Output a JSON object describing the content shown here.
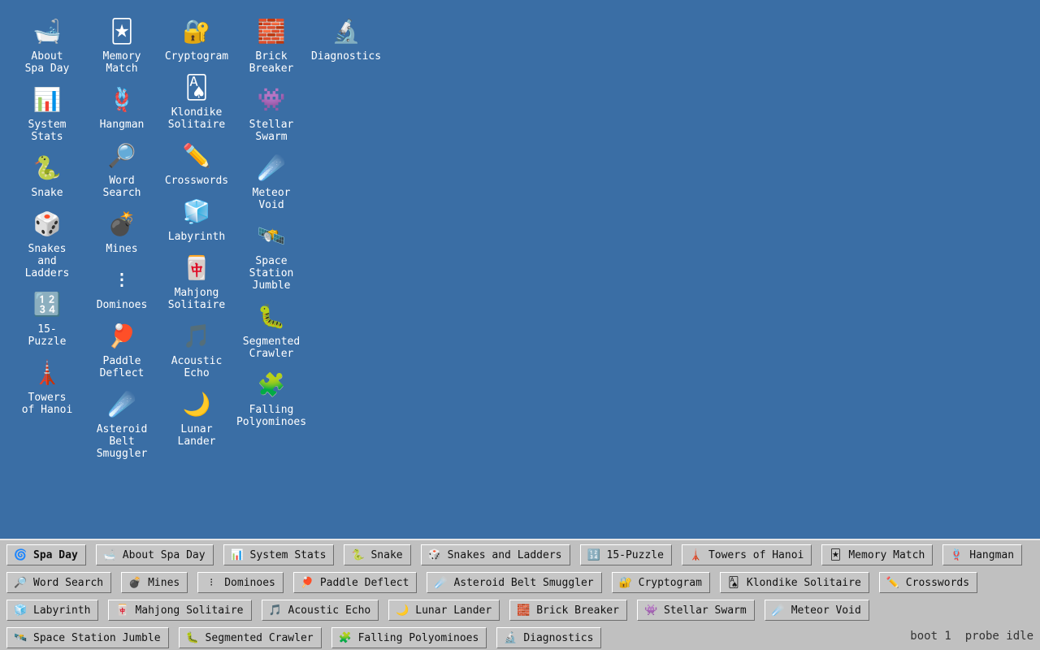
{
  "desktop": {
    "columns": [
      [
        {
          "name": "bathtub-icon",
          "glyph": "🛁",
          "label": "About\nSpa Day"
        },
        {
          "name": "bar-chart-icon",
          "glyph": "📊",
          "label": "System\nStats"
        },
        {
          "name": "snake-icon",
          "glyph": "🐍",
          "label": "Snake"
        },
        {
          "name": "dice-icon",
          "glyph": "🎲",
          "label": "Snakes\nand\nLadders"
        },
        {
          "name": "numbers-icon",
          "glyph": "🔢",
          "label": "15-\nPuzzle"
        },
        {
          "name": "tower-icon",
          "glyph": "🗼",
          "label": "Towers\nof Hanoi"
        }
      ],
      [
        {
          "name": "joker-card-icon",
          "glyph": "🃏",
          "label": "Memory\nMatch"
        },
        {
          "name": "hangman-icon",
          "glyph": "🪢",
          "label": "Hangman"
        },
        {
          "name": "magnifier-icon",
          "glyph": "🔎",
          "label": "Word\nSearch"
        },
        {
          "name": "bomb-icon",
          "glyph": "💣",
          "label": "Mines"
        },
        {
          "name": "domino-icon",
          "glyph": "⁝",
          "label": "Dominoes"
        },
        {
          "name": "ping-pong-icon",
          "glyph": "🏓",
          "label": "Paddle\nDeflect"
        },
        {
          "name": "comet-icon",
          "glyph": "☄️",
          "label": "Asteroid\nBelt\nSmuggler"
        }
      ],
      [
        {
          "name": "locked-key-icon",
          "glyph": "🔐",
          "label": "Cryptogram"
        },
        {
          "name": "playing-card-icon",
          "glyph": "🂡",
          "label": "Klondike\nSolitaire"
        },
        {
          "name": "pencil-icon",
          "glyph": "✏️",
          "label": "Crosswords"
        },
        {
          "name": "ice-cube-icon",
          "glyph": "🧊",
          "label": "Labyrinth"
        },
        {
          "name": "mahjong-tile-icon",
          "glyph": "🀄",
          "label": "Mahjong\nSolitaire"
        },
        {
          "name": "music-note-icon",
          "glyph": "🎵",
          "label": "Acoustic\nEcho"
        },
        {
          "name": "crescent-moon-icon",
          "glyph": "🌙",
          "label": "Lunar\nLander"
        }
      ],
      [
        {
          "name": "brick-icon",
          "glyph": "🧱",
          "label": "Brick\nBreaker"
        },
        {
          "name": "alien-monster-icon",
          "glyph": "👾",
          "label": "Stellar\nSwarm"
        },
        {
          "name": "comet-icon",
          "glyph": "☄️",
          "label": "Meteor\nVoid"
        },
        {
          "name": "satellite-icon",
          "glyph": "🛰️",
          "label": "Space\nStation\nJumble"
        },
        {
          "name": "caterpillar-icon",
          "glyph": "🐛",
          "label": "Segmented\nCrawler"
        },
        {
          "name": "puzzle-piece-icon",
          "glyph": "🧩",
          "label": "Falling\nPolyominoes"
        }
      ],
      [
        {
          "name": "microscope-icon",
          "glyph": "🔬",
          "label": "Diagnostics"
        }
      ]
    ]
  },
  "taskbar": {
    "rows": [
      [
        {
          "name": "start-button",
          "glyph": "🌀",
          "label": "Spa Day",
          "start": true
        },
        {
          "name": "about-spa-day",
          "glyph": "🛁",
          "label": "About Spa Day"
        },
        {
          "name": "system-stats",
          "glyph": "📊",
          "label": "System Stats"
        },
        {
          "name": "snake",
          "glyph": "🐍",
          "label": "Snake"
        },
        {
          "name": "snakes-and-ladders",
          "glyph": "🎲",
          "label": "Snakes and Ladders"
        },
        {
          "name": "15-puzzle",
          "glyph": "🔢",
          "label": "15-Puzzle"
        },
        {
          "name": "towers-of-hanoi",
          "glyph": "🗼",
          "label": "Towers of Hanoi"
        },
        {
          "name": "memory-match",
          "glyph": "🃏",
          "label": "Memory Match"
        },
        {
          "name": "hangman",
          "glyph": "🪢",
          "label": "Hangman"
        }
      ],
      [
        {
          "name": "word-search",
          "glyph": "🔎",
          "label": "Word Search"
        },
        {
          "name": "mines",
          "glyph": "💣",
          "label": "Mines"
        },
        {
          "name": "dominoes",
          "glyph": "⁝",
          "label": "Dominoes"
        },
        {
          "name": "paddle-deflect",
          "glyph": "🏓",
          "label": "Paddle Deflect"
        },
        {
          "name": "asteroid-belt-smuggler",
          "glyph": "☄️",
          "label": "Asteroid Belt Smuggler"
        },
        {
          "name": "cryptogram",
          "glyph": "🔐",
          "label": "Cryptogram"
        },
        {
          "name": "klondike-solitaire",
          "glyph": "🂡",
          "label": "Klondike Solitaire"
        },
        {
          "name": "crosswords",
          "glyph": "✏️",
          "label": "Crosswords"
        }
      ],
      [
        {
          "name": "labyrinth",
          "glyph": "🧊",
          "label": "Labyrinth"
        },
        {
          "name": "mahjong-solitaire",
          "glyph": "🀄",
          "label": "Mahjong Solitaire"
        },
        {
          "name": "acoustic-echo",
          "glyph": "🎵",
          "label": "Acoustic Echo"
        },
        {
          "name": "lunar-lander",
          "glyph": "🌙",
          "label": "Lunar Lander"
        },
        {
          "name": "brick-breaker",
          "glyph": "🧱",
          "label": "Brick Breaker"
        },
        {
          "name": "stellar-swarm",
          "glyph": "👾",
          "label": "Stellar Swarm"
        },
        {
          "name": "meteor-void",
          "glyph": "☄️",
          "label": "Meteor Void"
        }
      ],
      [
        {
          "name": "space-station-jumble",
          "glyph": "🛰️",
          "label": "Space Station Jumble"
        },
        {
          "name": "segmented-crawler",
          "glyph": "🐛",
          "label": "Segmented Crawler"
        },
        {
          "name": "falling-polyominoes",
          "glyph": "🧩",
          "label": "Falling Polyominoes"
        },
        {
          "name": "diagnostics",
          "glyph": "🔬",
          "label": "Diagnostics"
        }
      ]
    ],
    "status": "boot 1  probe idle"
  },
  "colors": {
    "desktop_bg": "#3a6ea5",
    "taskbar_bg": "#c0c0c0"
  }
}
